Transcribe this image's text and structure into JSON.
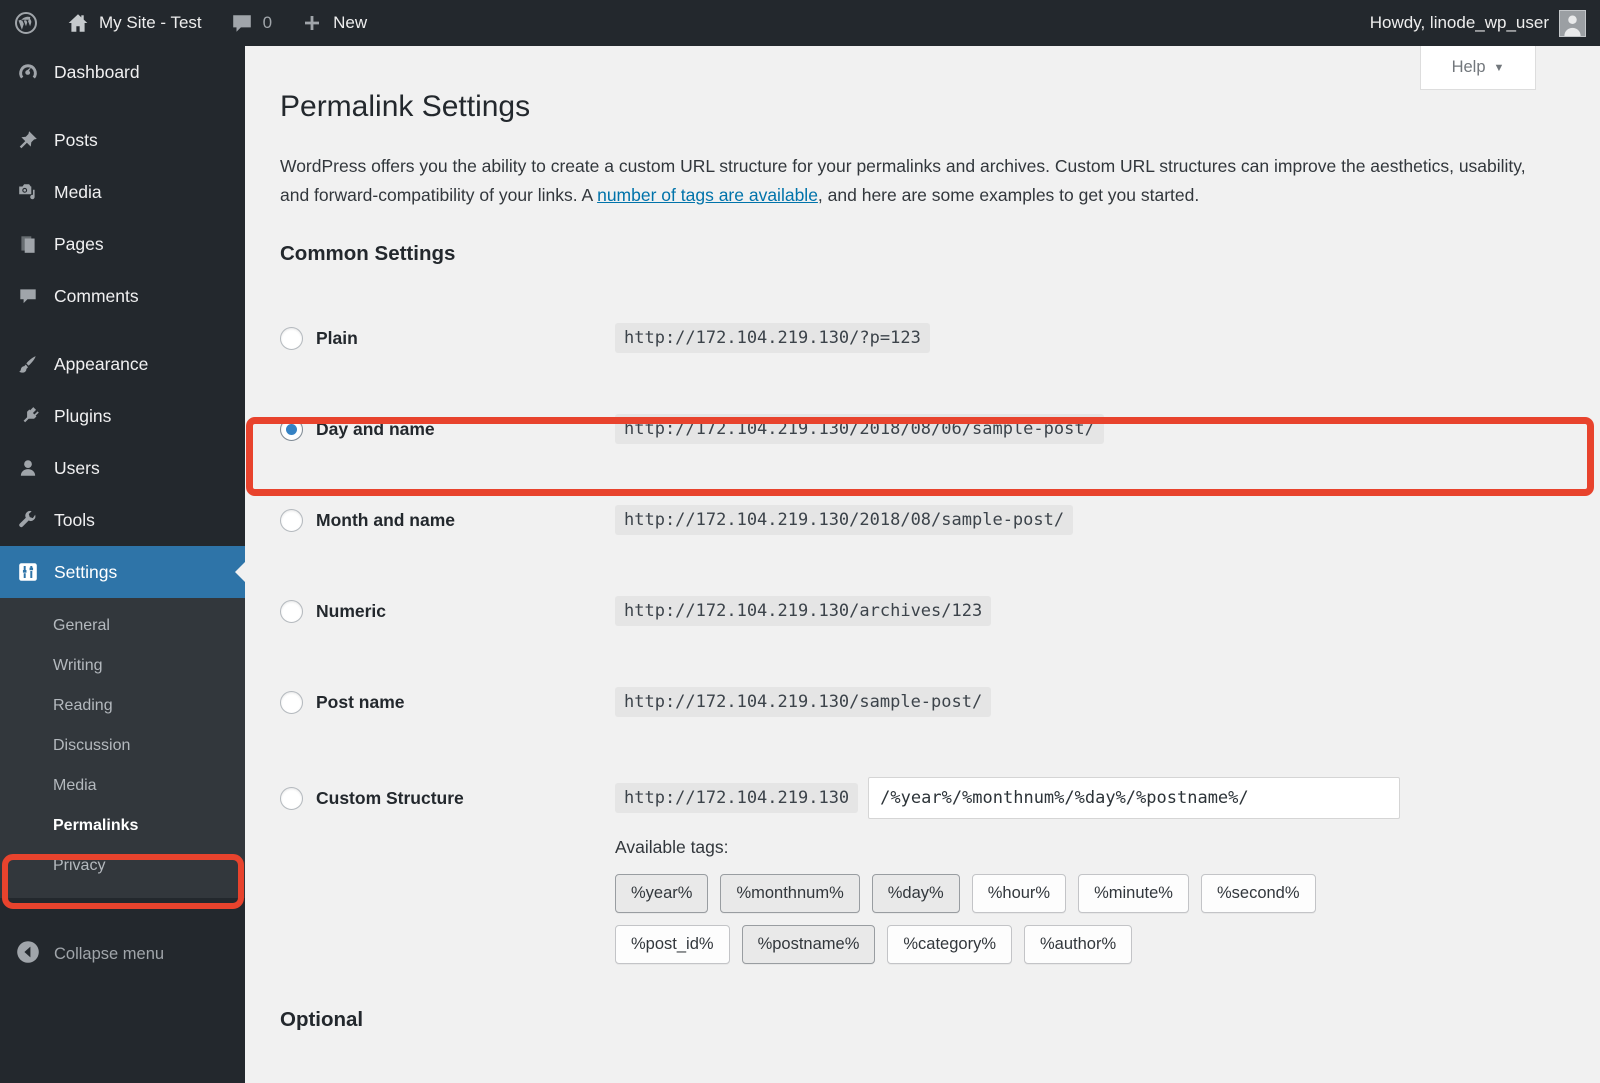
{
  "colors": {
    "accent_blue": "#2e74a8",
    "annotation_red": "#e8432d",
    "link_blue": "#0073aa",
    "radio_dot_blue": "#3582c4"
  },
  "adminbar": {
    "site_name": "My Site - Test",
    "comments_count": "0",
    "new_label": "New",
    "howdy": "Howdy, linode_wp_user"
  },
  "sidebar": {
    "items": [
      {
        "label": "Dashboard"
      },
      {
        "label": "Posts"
      },
      {
        "label": "Media"
      },
      {
        "label": "Pages"
      },
      {
        "label": "Comments"
      },
      {
        "label": "Appearance"
      },
      {
        "label": "Plugins"
      },
      {
        "label": "Users"
      },
      {
        "label": "Tools"
      },
      {
        "label": "Settings"
      }
    ],
    "submenu": [
      {
        "label": "General"
      },
      {
        "label": "Writing"
      },
      {
        "label": "Reading"
      },
      {
        "label": "Discussion"
      },
      {
        "label": "Media"
      },
      {
        "label": "Permalinks"
      },
      {
        "label": "Privacy"
      }
    ],
    "collapse_label": "Collapse menu"
  },
  "main": {
    "help_label": "Help",
    "title": "Permalink Settings",
    "intro": {
      "text_before": "WordPress offers you the ability to create a custom URL structure for your permalinks and archives. Custom URL structures can improve the aesthetics, usability, and forward-compatibility of your links. A ",
      "link_text": "number of tags are available",
      "text_after": ", and here are some examples to get you started."
    },
    "common_heading": "Common Settings",
    "rows": [
      {
        "label": "Plain",
        "code": "http://172.104.219.130/?p=123",
        "selected": false
      },
      {
        "label": "Day and name",
        "code": "http://172.104.219.130/2018/08/06/sample-post/",
        "selected": true
      },
      {
        "label": "Month and name",
        "code": "http://172.104.219.130/2018/08/sample-post/",
        "selected": false
      },
      {
        "label": "Numeric",
        "code": "http://172.104.219.130/archives/123",
        "selected": false
      },
      {
        "label": "Post name",
        "code": "http://172.104.219.130/sample-post/",
        "selected": false
      }
    ],
    "custom": {
      "label": "Custom Structure",
      "prefix": "http://172.104.219.130",
      "input_value": "/%year%/%monthnum%/%day%/%postname%/"
    },
    "available_tags_label": "Available tags:",
    "tags": [
      {
        "label": "%year%",
        "used": true
      },
      {
        "label": "%monthnum%",
        "used": true
      },
      {
        "label": "%day%",
        "used": true
      },
      {
        "label": "%hour%",
        "used": false
      },
      {
        "label": "%minute%",
        "used": false
      },
      {
        "label": "%second%",
        "used": false
      },
      {
        "label": "%post_id%",
        "used": false
      },
      {
        "label": "%postname%",
        "used": true
      },
      {
        "label": "%category%",
        "used": false
      },
      {
        "label": "%author%",
        "used": false
      }
    ],
    "optional_heading": "Optional"
  }
}
